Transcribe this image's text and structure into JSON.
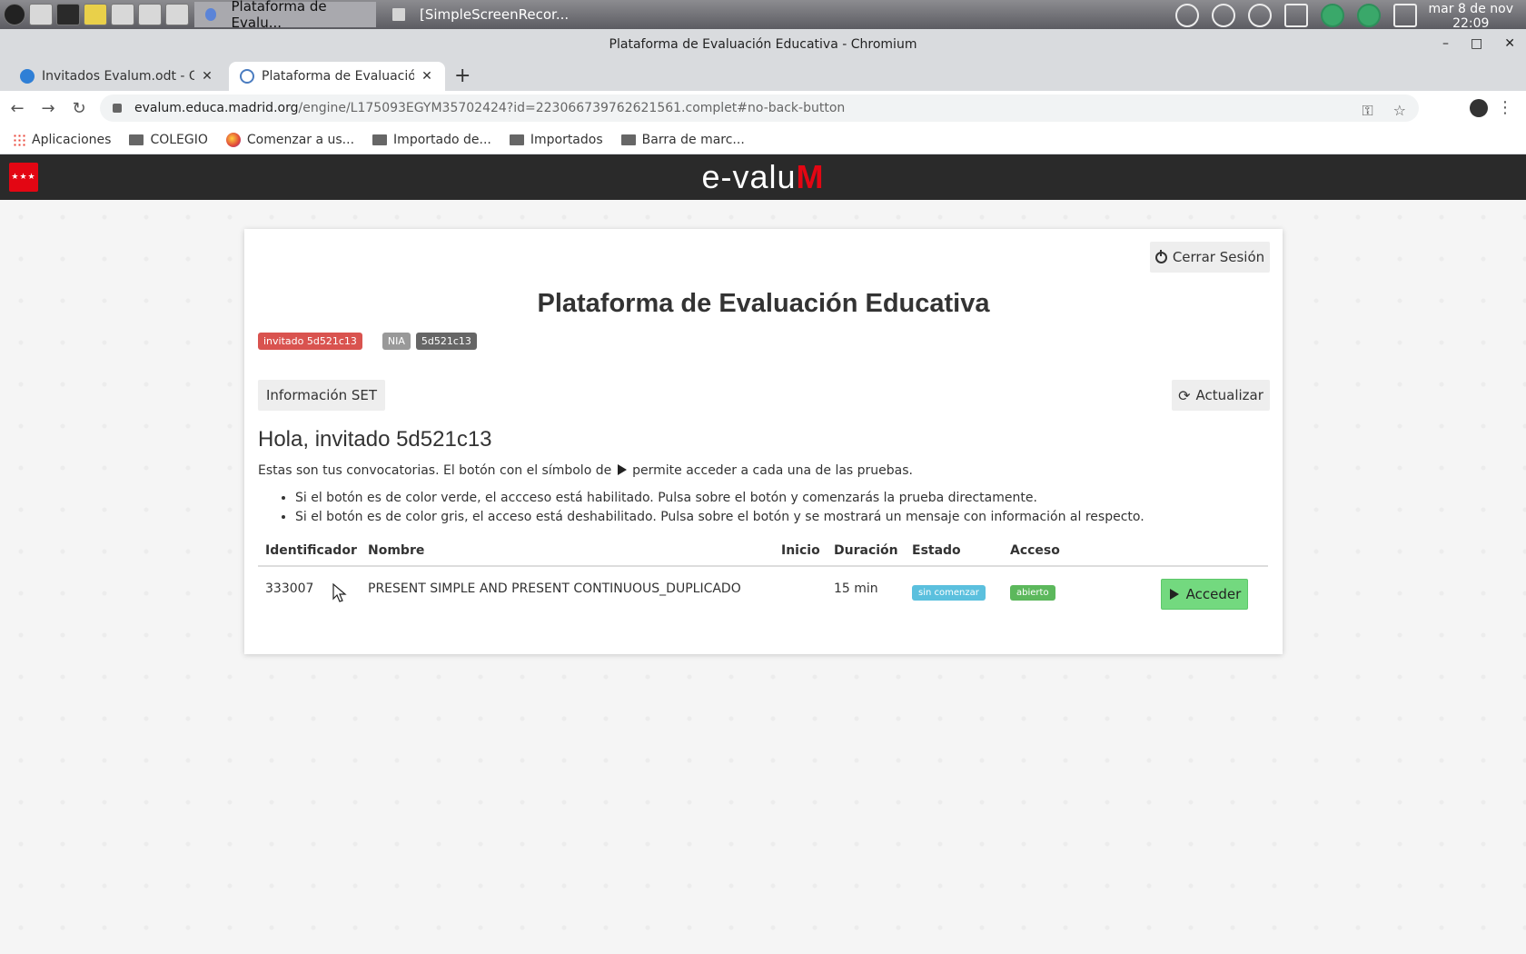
{
  "os": {
    "taskbar_tasks": [
      "Plataforma de Evalu...",
      "[SimpleScreenRecor..."
    ],
    "clock_date": "mar 8 de nov",
    "clock_time": "22:09"
  },
  "browser": {
    "window_title": "Plataforma de Evaluación Educativa - Chromium",
    "tabs": [
      {
        "title": "Invitados Evalum.odt - Of",
        "icon": "cloud-icon"
      },
      {
        "title": "Plataforma de Evaluación",
        "icon": "globe-icon"
      }
    ],
    "url_host": "evalum.educa.madrid.org",
    "url_path": "/engine/L175093EGYM35702424?id=223066739762621561.complet#no-back-button",
    "bookmarks": [
      "Aplicaciones",
      "COLEGIO",
      "Comenzar a us...",
      "Importado de...",
      "Importados",
      "Barra de marc..."
    ]
  },
  "site": {
    "logo_text": "e-valu",
    "logo_accent": "M",
    "logo_colors": {
      "accent": "#e30613",
      "header_bg": "#2a2a2a"
    }
  },
  "card": {
    "logout_label": "Cerrar Sesión",
    "title": "Plataforma de Evaluación Educativa",
    "badge_user": "invitado 5d521c13",
    "badge_nia_label": "NIA",
    "badge_nia_value": "5d521c13",
    "info_set_label": "Información SET",
    "refresh_label": "Actualizar",
    "greeting": "Hola, invitado 5d521c13",
    "intro_before": "Estas son tus convocatorias. El botón con el símbolo de",
    "intro_after": "permite acceder a cada una de las pruebas.",
    "bullets": [
      "Si el botón es de color verde, el accceso está habilitado. Pulsa sobre el botón y comenzarás la prueba directamente.",
      "Si el botón es de color gris, el acceso está deshabilitado. Pulsa sobre el botón y se mostrará un mensaje con información al respecto."
    ]
  },
  "table": {
    "headers": {
      "id": "Identificador",
      "name": "Nombre",
      "start": "Inicio",
      "duration": "Duración",
      "status": "Estado",
      "access": "Acceso"
    },
    "rows": [
      {
        "id": "333007",
        "name": "PRESENT SIMPLE AND PRESENT CONTINUOUS_DUPLICADO",
        "start": "",
        "duration": "15 min",
        "status": "sin comenzar",
        "access": "abierto",
        "button": "Acceder"
      }
    ]
  }
}
